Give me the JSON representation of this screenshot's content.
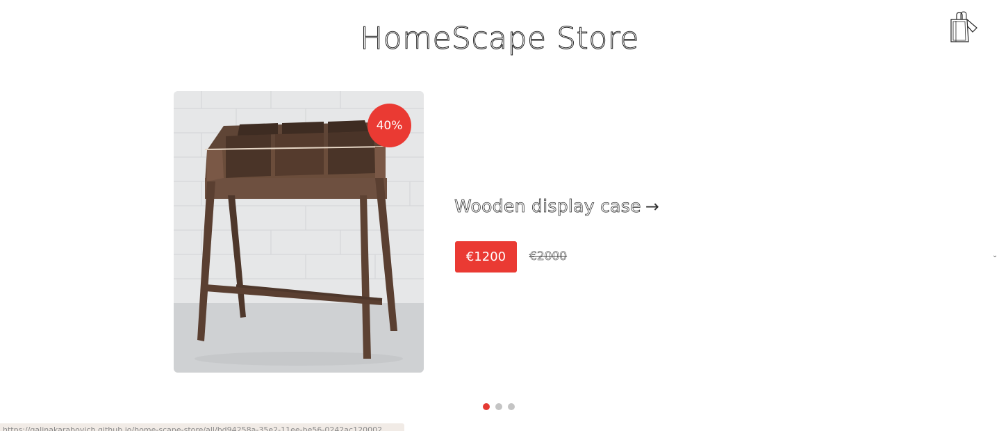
{
  "header": {
    "title": "HomeScape Store",
    "cart_icon": "shopping-bag-icon"
  },
  "product": {
    "discount": "40%",
    "name": "Wooden display case",
    "arrow": "→",
    "price": "€1200",
    "old_price": "€2000",
    "image_alt": "Wooden display case"
  },
  "carousel": {
    "active_index": 0,
    "dots": [
      "",
      "",
      ""
    ]
  },
  "status_bar": {
    "url": "https://galinakarabovich.github.io/home-scape-store/all/bd94258a-35e2-11ee-be56-0242ac120002"
  },
  "colors": {
    "accent": "#ea3a33",
    "dot_inactive": "#c4c4c4"
  }
}
